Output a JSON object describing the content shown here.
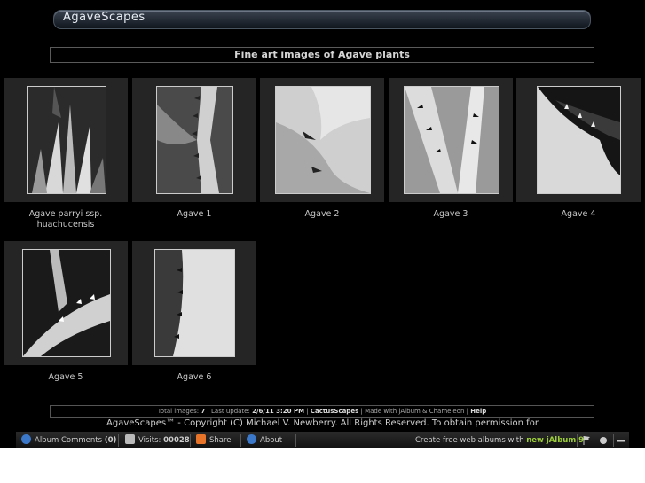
{
  "site_title": "AgaveScapes",
  "subtitle": "Fine art images of Agave plants",
  "gallery": [
    {
      "caption": "Agave parryi ssp. huachucensis"
    },
    {
      "caption": "Agave 1"
    },
    {
      "caption": "Agave 2"
    },
    {
      "caption": "Agave 3"
    },
    {
      "caption": "Agave 4"
    },
    {
      "caption": "Agave 5"
    },
    {
      "caption": "Agave 6"
    }
  ],
  "stats": {
    "total_label": "Total images:",
    "total_value": "7",
    "update_label": "Last update:",
    "update_value": "2/6/11 3:20 PM",
    "link": "CactusScapes",
    "made_with": "Made with jAlbum & Chameleon",
    "help": "Help"
  },
  "copyright": "AgaveScapes™ - Copyright (C) Michael V. Newberry. All Rights Reserved. To obtain permission for",
  "bottombar": {
    "comments_label": "Album Comments",
    "comments_count": "(0)",
    "visits_label": "Visits:",
    "visits_count": "00028",
    "share_label": "Share",
    "about_label": "About",
    "promo_text": "Create free web albums with",
    "promo_link": "new jAlbum 9"
  }
}
